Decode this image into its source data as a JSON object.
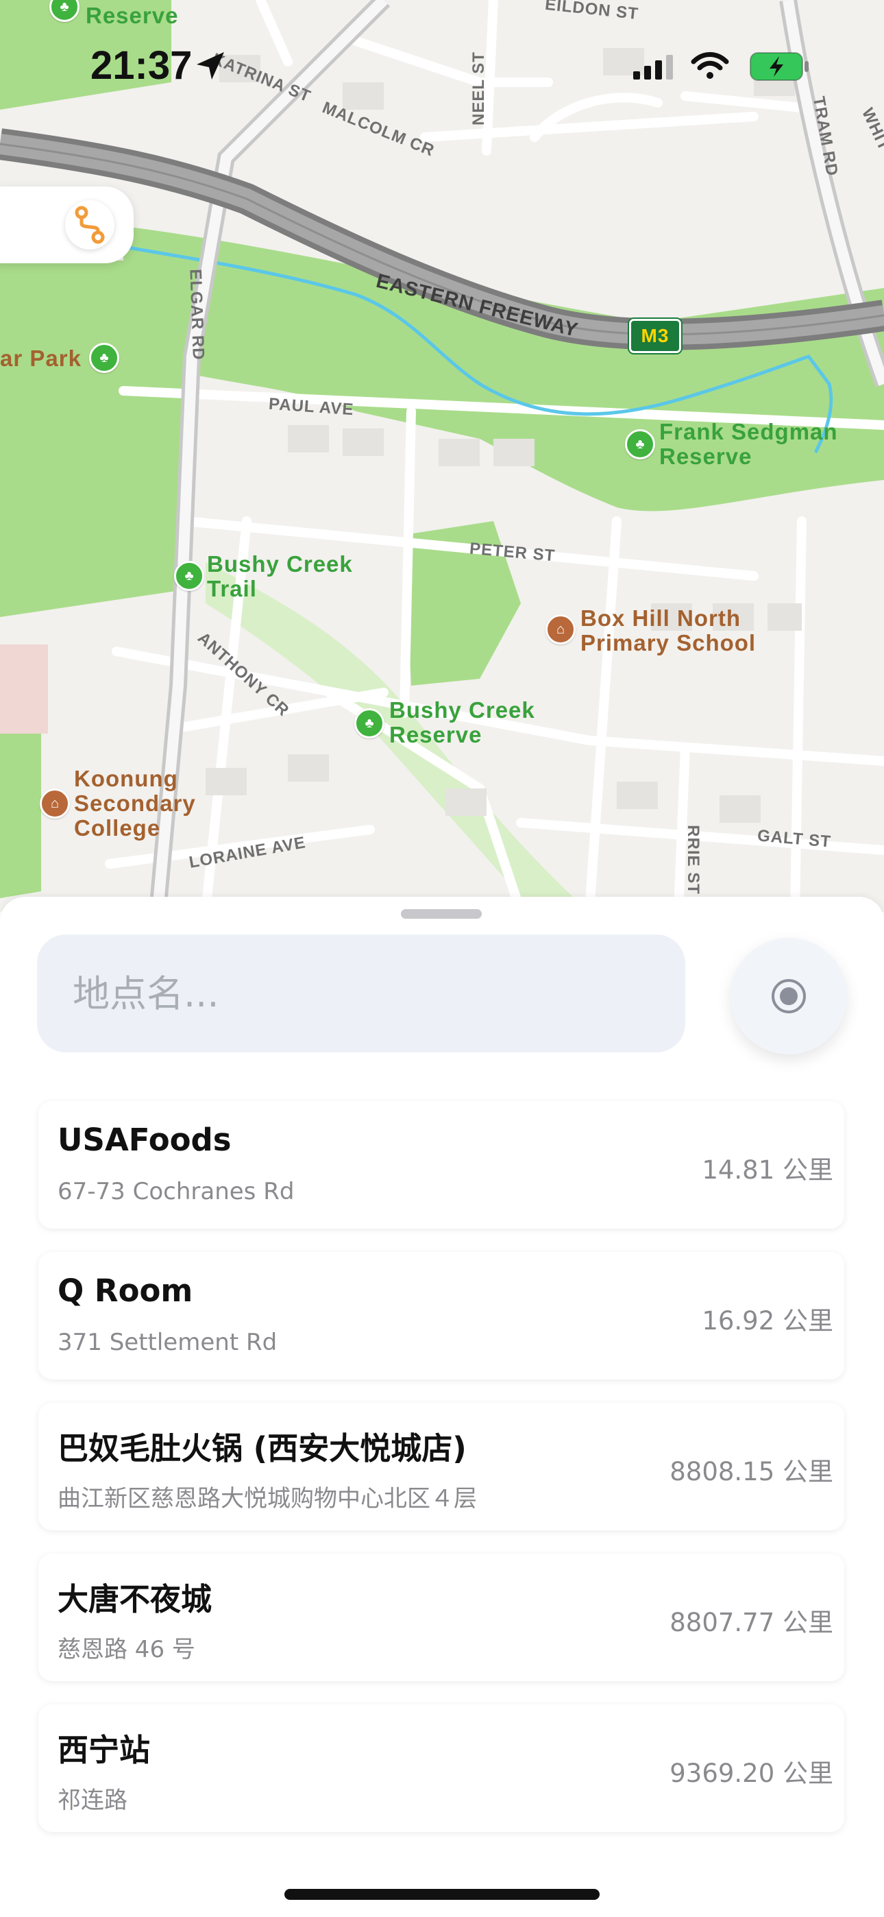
{
  "status_bar": {
    "time": "21:37"
  },
  "map": {
    "labels": {
      "eildon_st": "EILDON ST",
      "katrina_st": "KATRINA ST",
      "malcolm_cr": "MALCOLM CR",
      "neel_st": "NEEL ST",
      "tram_rd": "TRAM RD",
      "whit": "WHIT",
      "eastern_freeway": "EASTERN FREEWAY",
      "route_shield": "M3",
      "elgar_rd": "ELGAR RD",
      "paul_ave": "PAUL AVE",
      "peter_st": "PETER ST",
      "anthony_cr": "ANTHONY CR",
      "loraine_ave": "LORAINE AVE",
      "galt_st": "GALT ST",
      "rrie_st": "RRIE ST",
      "reserve_top": "Reserve",
      "ar_park": "ar Park",
      "frank_sedgman_1": "Frank Sedgman",
      "frank_sedgman_2": "Reserve",
      "bushy_trail_1": "Bushy Creek",
      "bushy_trail_2": "Trail",
      "box_hill_1": "Box Hill North",
      "box_hill_2": "Primary School",
      "bushy_reserve_1": "Bushy Creek",
      "bushy_reserve_2": "Reserve",
      "koonung_1": "Koonung",
      "koonung_2": "Secondary",
      "koonung_3": "College"
    }
  },
  "search": {
    "placeholder": "地点名..."
  },
  "places": [
    {
      "name": "USAFoods",
      "address": "67-73 Cochranes Rd",
      "distance": "14.81 公里"
    },
    {
      "name": "Q Room",
      "address": "371 Settlement Rd",
      "distance": "16.92 公里"
    },
    {
      "name": "巴奴毛肚火锅 (西安大悦城店)",
      "address": "曲江新区慈恩路大悦城购物中心北区４层",
      "distance": "8808.15 公里"
    },
    {
      "name": "大唐不夜城",
      "address": "慈恩路 46 号",
      "distance": "8807.77 公里"
    },
    {
      "name": "西宁站",
      "address": "祁连路",
      "distance": "9369.20 公里"
    }
  ],
  "colors": {
    "park_green": "#a9dc8a",
    "water": "#5bc7e8",
    "accent_orange": "#f29b3a",
    "battery_green": "#35c759"
  }
}
